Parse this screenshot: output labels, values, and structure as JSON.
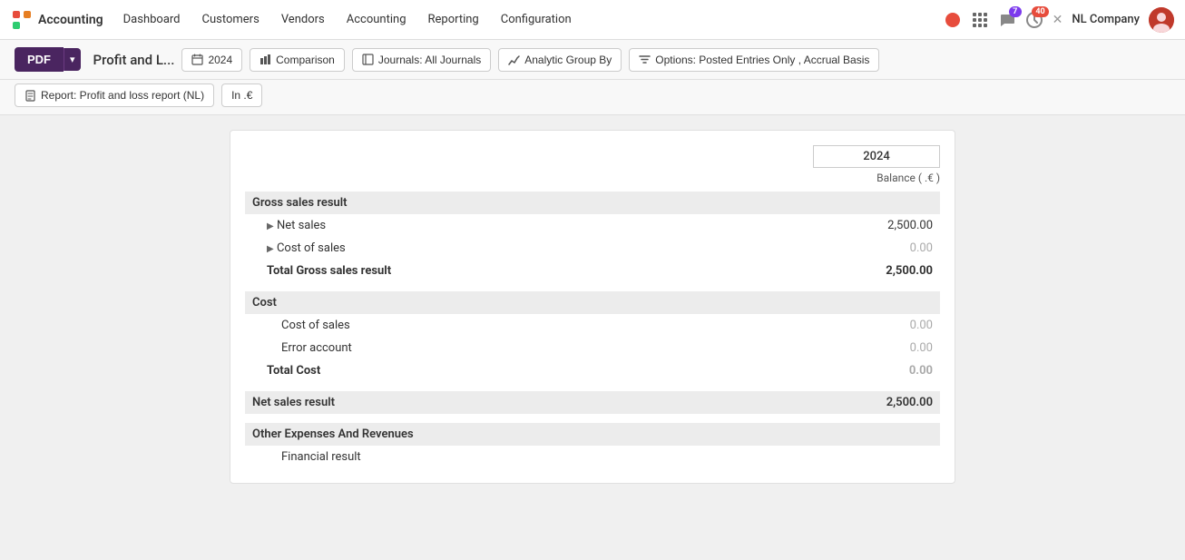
{
  "app": {
    "logo_text": "Accounting",
    "nav_items": [
      "Dashboard",
      "Customers",
      "Vendors",
      "Accounting",
      "Reporting",
      "Configuration"
    ]
  },
  "topnav_right": {
    "notification_count": "7",
    "activity_count": "40",
    "company": "NL Company"
  },
  "toolbar": {
    "pdf_label": "PDF",
    "report_title": "Profit and L...",
    "btn_year": "2024",
    "btn_comparison": "Comparison",
    "btn_journals": "Journals: All Journals",
    "btn_analytic": "Analytic Group By",
    "btn_options": "Options: Posted Entries Only , Accrual Basis",
    "btn_report": "Report: Profit and loss report (NL)",
    "btn_currency": "In .€"
  },
  "report": {
    "year_label": "2024",
    "balance_header": "Balance ( .€ )",
    "sections": [
      {
        "id": "gross-sales",
        "header": "Gross sales result",
        "rows": [
          {
            "id": "net-sales",
            "label": "Net sales",
            "amount": "2,500.00",
            "indent": 1,
            "expandable": true,
            "zero": false
          },
          {
            "id": "cost-of-sales-1",
            "label": "Cost of sales",
            "amount": "0.00",
            "indent": 1,
            "expandable": true,
            "zero": true
          }
        ],
        "total_label": "Total Gross sales result",
        "total_amount": "2,500.00",
        "total_zero": false
      },
      {
        "id": "cost",
        "header": "Cost",
        "rows": [
          {
            "id": "cost-of-sales-2",
            "label": "Cost of sales",
            "amount": "0.00",
            "indent": 2,
            "expandable": false,
            "zero": true
          },
          {
            "id": "error-account",
            "label": "Error account",
            "amount": "0.00",
            "indent": 2,
            "expandable": false,
            "zero": true
          }
        ],
        "total_label": "Total Cost",
        "total_amount": "0.00",
        "total_zero": true
      },
      {
        "id": "net-sales-result",
        "header": "Net sales result",
        "is_net": true,
        "amount": "2,500.00"
      },
      {
        "id": "other-expenses",
        "header": "Other Expenses And Revenues",
        "rows": [
          {
            "id": "financial-result",
            "label": "Financial result",
            "amount": "",
            "indent": 2,
            "expandable": false,
            "zero": false
          }
        ]
      }
    ]
  }
}
